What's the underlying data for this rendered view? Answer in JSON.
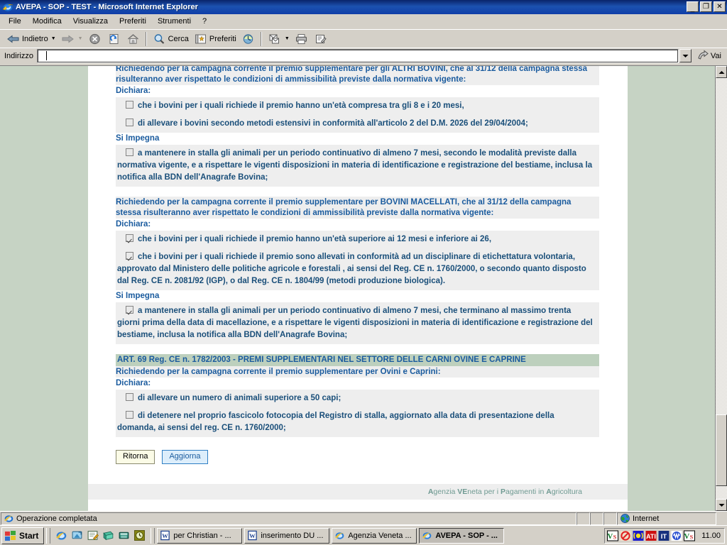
{
  "window": {
    "title": "AVEPA - SOP - TEST - Microsoft Internet Explorer",
    "minimize_label": "_",
    "maximize_label": "❐",
    "close_label": "✕"
  },
  "menu": {
    "items": [
      {
        "label": "File"
      },
      {
        "label": "Modifica"
      },
      {
        "label": "Visualizza"
      },
      {
        "label": "Preferiti"
      },
      {
        "label": "Strumenti"
      },
      {
        "label": "?"
      }
    ]
  },
  "toolbar": {
    "back_label": "Indietro",
    "forward_label": "",
    "stop_label": "",
    "refresh_label": "",
    "home_label": "",
    "search_label": "Cerca",
    "favorites_label": "Preferiti",
    "history_label": "",
    "mail_label": "",
    "print_label": "",
    "edit_label": ""
  },
  "address": {
    "label": "Indirizzo",
    "value": "",
    "placeholder": "",
    "go_label": "Vai"
  },
  "page": {
    "sections": [
      {
        "lead": "Richiedendo per la campagna corrente il premio supplementare per gli ALTRI BOVINI, che al 31/12 della campagna stessa risulteranno aver rispettato le condizioni di ammissibilità previste dalla normativa vigente:",
        "declare_label": "Dichiara:",
        "declare_items": [
          {
            "checked": false,
            "text": "che i bovini per i quali richiede il premio hanno un'età compresa tra gli 8 e i 20 mesi,"
          },
          {
            "checked": false,
            "text": "di allevare i bovini secondo metodi estensivi in conformità all'articolo 2 del D.M. 2026 del 29/04/2004;"
          }
        ],
        "commit_label": "Si Impegna",
        "commit_items": [
          {
            "checked": false,
            "text": "a mantenere in stalla gli animali per un periodo continuativo di almeno 7 mesi, secondo le modalità previste dalla normativa vigente, e a rispettare le vigenti disposizioni in materia di identificazione e registrazione del bestiame, inclusa la notifica alla BDN dell'Anagrafe Bovina;"
          }
        ]
      },
      {
        "lead": "Richiedendo per la campagna corrente il premio supplementare per BOVINI MACELLATI, che al 31/12 della campagna stessa risulteranno aver rispettato le condizioni di ammissibilità previste dalla normativa vigente:",
        "declare_label": "Dichiara:",
        "declare_items": [
          {
            "checked": true,
            "text": "che i bovini per i quali richiede il premio hanno un'età superiore ai 12 mesi e inferiore ai 26,"
          },
          {
            "checked": true,
            "text": "che i bovini per i quali richiede il premio sono allevati in conformità ad un disciplinare di etichettatura volontaria, approvato dal Ministero delle politiche agricole e forestali , ai sensi del Reg. CE n. 1760/2000, o secondo quanto disposto dal Reg. CE n. 2081/92 (IGP), o dal Reg. CE n. 1804/99 (metodi produzione biologica)."
          }
        ],
        "commit_label": "Si Impegna",
        "commit_items": [
          {
            "checked": true,
            "text": "a mantenere in stalla gli animali per un periodo continuativo di almeno 7 mesi, che terminano al massimo trenta giorni prima della data di macellazione, e a rispettare le vigenti disposizioni in materia di identificazione e registrazione del bestiame, inclusa la notifica alla BDN dell'Anagrafe Bovina;"
          }
        ]
      },
      {
        "banner": "ART. 69 Reg. CE n. 1782/2003 - PREMI SUPPLEMENTARI NEL SETTORE DELLE CARNI OVINE E CAPRINE",
        "lead": "Richiedendo per la campagna corrente il premio supplementare per Ovini e Caprini:",
        "declare_label": "Dichiara:",
        "declare_items": [
          {
            "checked": false,
            "text": "di allevare un numero di animali superiore a 50 capi;"
          },
          {
            "checked": false,
            "text": "di detenere nel proprio fascicolo fotocopia del Registro di stalla, aggiornato alla data di presentazione della domanda, ai sensi del reg. CE n. 1760/2000;"
          }
        ],
        "commit_label": "",
        "commit_items": []
      }
    ],
    "buttons": {
      "back_label": "Ritorna",
      "update_label": "Aggiorna"
    },
    "footer": {
      "a1": "A",
      "t1": "genzia ",
      "a2": "VE",
      "t2": "neta per i ",
      "a3": "P",
      "t3": "agamenti in ",
      "a4": "A",
      "t4": "gricoltura"
    }
  },
  "statusbar": {
    "message": "Operazione completata",
    "zone": "Internet"
  },
  "taskbar": {
    "start_label": "Start",
    "quicklaunch": [
      {
        "name": "internet-explorer-icon"
      },
      {
        "name": "show-desktop-icon"
      },
      {
        "name": "outlook-express-icon"
      },
      {
        "name": "media-player-icon"
      },
      {
        "name": "calculator-icon"
      },
      {
        "name": "clock-icon"
      }
    ],
    "tasks": [
      {
        "label": "per Christian - ...",
        "icon": "word-icon",
        "active": false
      },
      {
        "label": "inserimento DU ...",
        "icon": "word-icon",
        "active": false
      },
      {
        "label": "Agenzia Veneta ...",
        "icon": "internet-explorer-icon",
        "active": false
      },
      {
        "label": "AVEPA - SOP - ...",
        "icon": "internet-explorer-icon",
        "active": true
      }
    ],
    "tray_icons": [
      {
        "name": "virusscan-icon"
      },
      {
        "name": "no-entry-icon"
      },
      {
        "name": "speaker-icon"
      },
      {
        "name": "ati-icon"
      },
      {
        "name": "language-it-icon"
      },
      {
        "name": "network-icon"
      },
      {
        "name": "virusscan2-icon"
      }
    ],
    "clock": "11.00"
  }
}
